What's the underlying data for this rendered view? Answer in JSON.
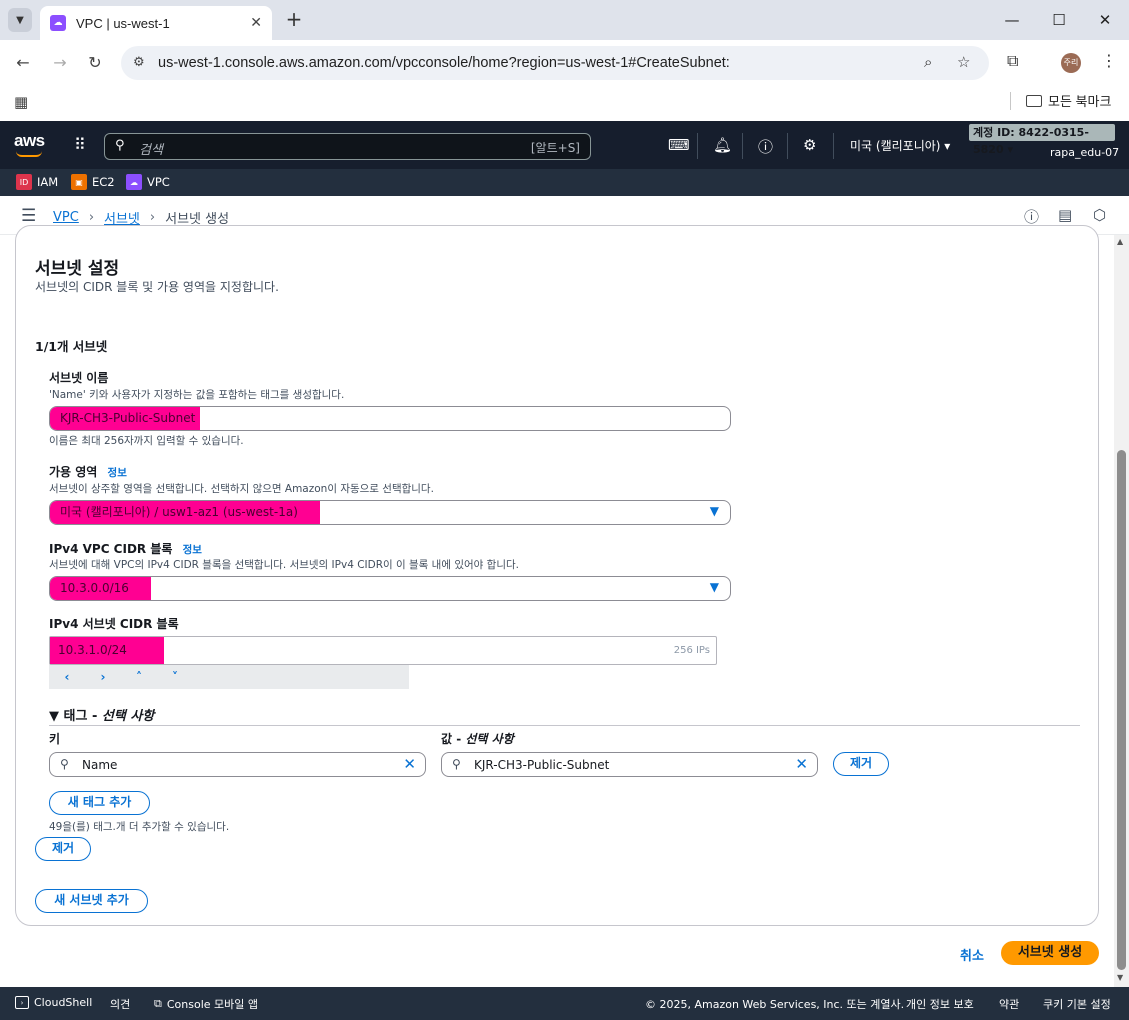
{
  "browser": {
    "tab_title": "VPC | us-west-1",
    "url": "us-west-1.console.aws.amazon.com/vpcconsole/home?region=us-west-1#CreateSubnet:",
    "profile_initials": "주리",
    "bookmarks_folder": "모든 북마크"
  },
  "aws_header": {
    "logo": "aws",
    "search_placeholder": "검색",
    "search_shortcut": "[알트+S]",
    "region": "미국 (캘리포니아) ▾",
    "account_id": "계정 ID: 8422-0315-5820 ▾",
    "user": "rapa_edu-07"
  },
  "favorites": [
    {
      "label": "IAM",
      "color": "#dd344c"
    },
    {
      "label": "EC2",
      "color": "#ed7100"
    },
    {
      "label": "VPC",
      "color": "#8c4fff"
    }
  ],
  "breadcrumbs": {
    "vpc": "VPC",
    "subnets": "서브넷",
    "current": "서브넷 생성"
  },
  "form": {
    "section_title": "서브넷 설정",
    "section_desc": "서브넷의 CIDR 블록 및 가용 영역을 지정합니다.",
    "subnet_counter": "1/1개 서브넷",
    "name": {
      "label": "서브넷 이름",
      "desc": "'Name' 키와 사용자가 지정하는 값을 포함하는 태그를 생성합니다.",
      "value": "KJR-CH3-Public-Subnet",
      "hint": "이름은 최대 256자까지 입력할 수 있습니다."
    },
    "az": {
      "label": "가용 영역",
      "info": "정보",
      "desc": "서브넷이 상주할 영역을 선택합니다. 선택하지 않으면 Amazon이 자동으로 선택합니다.",
      "value": "미국 (캘리포니아) / usw1-az1 (us-west-1a)"
    },
    "vpc_cidr": {
      "label": "IPv4 VPC CIDR 블록",
      "info": "정보",
      "desc": "서브넷에 대해 VPC의 IPv4 CIDR 블록을 선택합니다. 서브넷의 IPv4 CIDR이 이 블록 내에 있어야 합니다.",
      "value": "10.3.0.0/16"
    },
    "subnet_cidr": {
      "label": "IPv4 서브넷 CIDR 블록",
      "value": "10.3.1.0/24",
      "ips": "256 IPs",
      "stepper": [
        "‹",
        "›",
        "˄",
        "˅"
      ]
    },
    "tags": {
      "header_prefix": "▼ 태그 - ",
      "header_optional": "선택 사항",
      "key_label": "키",
      "value_label_prefix": "값 - ",
      "value_label_optional": "선택 사항",
      "key": "Name",
      "value": "KJR-CH3-Public-Subnet",
      "remove": "제거",
      "add_tag": "새 태그 추가",
      "remaining": "49을(를) 태그.개 더 추가할 수 있습니다."
    },
    "remove_subnet": "제거",
    "add_subnet": "새 서브넷 추가"
  },
  "actions": {
    "cancel": "취소",
    "create": "서브넷 생성"
  },
  "footer": {
    "cloudshell": "CloudShell",
    "feedback": "의견",
    "console_mobile": "Console 모바일 앱",
    "copyright": "© 2025, Amazon Web Services, Inc. 또는 계열사.",
    "privacy": "개인 정보 보호",
    "terms": "약관",
    "cookies": "쿠키 기본 설정"
  },
  "colors": {
    "redaction": "#ff0092",
    "link": "#0972d3",
    "primary": "#ff9900",
    "aws_header": "#161e2d"
  }
}
